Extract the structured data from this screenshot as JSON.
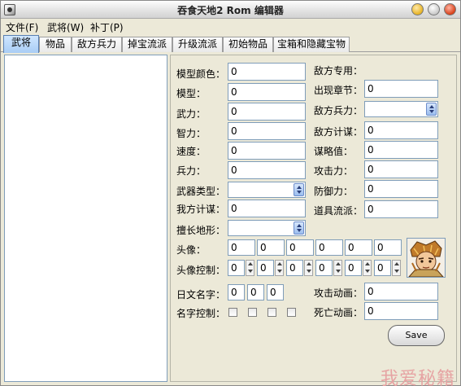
{
  "window": {
    "title": "吞食天地2 Rom 编辑器"
  },
  "menu": [
    "文件(F)",
    "武将(W)",
    "补丁(P)"
  ],
  "tabs": [
    "武将",
    "物品",
    "敌方兵力",
    "掉宝流派",
    "升级流派",
    "初始物品",
    "宝箱和隐藏宝物"
  ],
  "left_fields": {
    "model_color": {
      "label": "模型颜色：",
      "value": "0"
    },
    "model": {
      "label": "模型：",
      "value": "0"
    },
    "force": {
      "label": "武力：",
      "value": "0"
    },
    "intelligence": {
      "label": "智力：",
      "value": "0"
    },
    "speed": {
      "label": "速度：",
      "value": "0"
    },
    "troops": {
      "label": "兵力：",
      "value": "0"
    },
    "weapon_type": {
      "label": "武器类型：",
      "value": ""
    },
    "our_strategy": {
      "label": "我方计谋：",
      "value": "0"
    },
    "terrain": {
      "label": "擅长地形：",
      "value": ""
    }
  },
  "right_fields": {
    "enemy_only": {
      "label": "敌方专用："
    },
    "chapter": {
      "label": "出现章节：",
      "value": "0"
    },
    "enemy_troops": {
      "label": "敌方兵力：",
      "value": ""
    },
    "enemy_strategy": {
      "label": "敌方计谋：",
      "value": "0"
    },
    "strategy_value": {
      "label": "谋略值：",
      "value": "0"
    },
    "attack": {
      "label": "攻击力：",
      "value": "0"
    },
    "defense": {
      "label": "防御力：",
      "value": "0"
    },
    "item_school": {
      "label": "道具流派：",
      "value": "0"
    }
  },
  "portrait": {
    "label": "头像：",
    "values": [
      "0",
      "0",
      "0",
      "0",
      "0",
      "0"
    ],
    "control_label": "头像控制：",
    "controls": [
      "0",
      "0",
      "0",
      "0",
      "0",
      "0"
    ]
  },
  "jp_name": {
    "label": "日文名字：",
    "values": [
      "0",
      "0",
      "0"
    ]
  },
  "name_control": {
    "label": "名字控制："
  },
  "attack_anim": {
    "label": "攻击动画：",
    "value": "0"
  },
  "death_anim": {
    "label": "死亡动画：",
    "value": "0"
  },
  "save_label": "Save",
  "watermark": "我爱秘籍"
}
